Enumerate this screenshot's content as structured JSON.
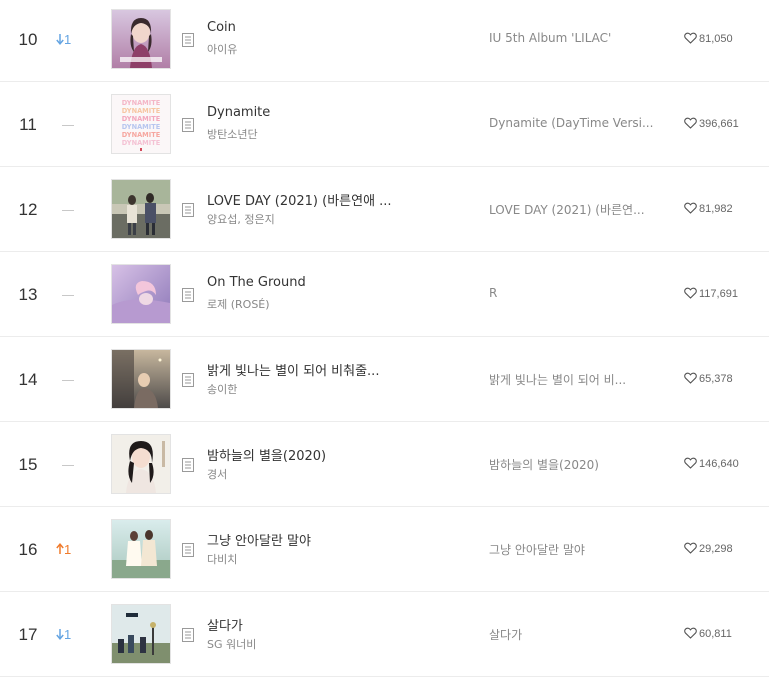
{
  "chart_rows": [
    {
      "rank": "10",
      "change": {
        "dir": "down",
        "amount": "1"
      },
      "title": "Coin",
      "artist": "아이유",
      "album": "IU 5th Album 'LILAC'",
      "likes": "81,050",
      "art": "lilac"
    },
    {
      "rank": "11",
      "change": {
        "dir": "same",
        "amount": ""
      },
      "title": "Dynamite",
      "artist": "방탄소년단",
      "album": "Dynamite (DayTime Versi...",
      "likes": "396,661",
      "art": "dynamite"
    },
    {
      "rank": "12",
      "change": {
        "dir": "same",
        "amount": ""
      },
      "title": "LOVE DAY (2021) (바른연애 ...",
      "artist": "양요섭, 정은지",
      "album": "LOVE DAY (2021) (바른연...",
      "likes": "81,982",
      "art": "loveday"
    },
    {
      "rank": "13",
      "change": {
        "dir": "same",
        "amount": ""
      },
      "title": "On The Ground",
      "artist": "로제 (ROSÉ)",
      "album": "R",
      "likes": "117,691",
      "art": "rose"
    },
    {
      "rank": "14",
      "change": {
        "dir": "same",
        "amount": ""
      },
      "title": "밝게 빛나는 별이 되어 비춰줄...",
      "artist": "송이한",
      "album": "밝게 빛나는 별이 되어 비...",
      "likes": "65,378",
      "art": "star"
    },
    {
      "rank": "15",
      "change": {
        "dir": "same",
        "amount": ""
      },
      "title": "밤하늘의 별을(2020)",
      "artist": "경서",
      "album": "밤하늘의 별을(2020)",
      "likes": "146,640",
      "art": "night"
    },
    {
      "rank": "16",
      "change": {
        "dir": "up",
        "amount": "1"
      },
      "title": "그냥 안아달란 말야",
      "artist": "다비치",
      "album": "그냥 안아달란 말야",
      "likes": "29,298",
      "art": "davichi"
    },
    {
      "rank": "17",
      "change": {
        "dir": "down",
        "amount": "1"
      },
      "title": "살다가",
      "artist": "SG 워너비",
      "album": "살다가",
      "likes": "60,811",
      "art": "sg"
    }
  ],
  "colors": {
    "up": "#f07a2b",
    "down": "#64a4e2",
    "same": "#c8c8c8",
    "border": "#ececec"
  },
  "icons": {
    "lyrics": "lyrics-document-icon",
    "like": "heart-outline-icon",
    "up": "arrow-up-icon",
    "down": "arrow-down-icon",
    "same": "no-change-dash-icon"
  }
}
